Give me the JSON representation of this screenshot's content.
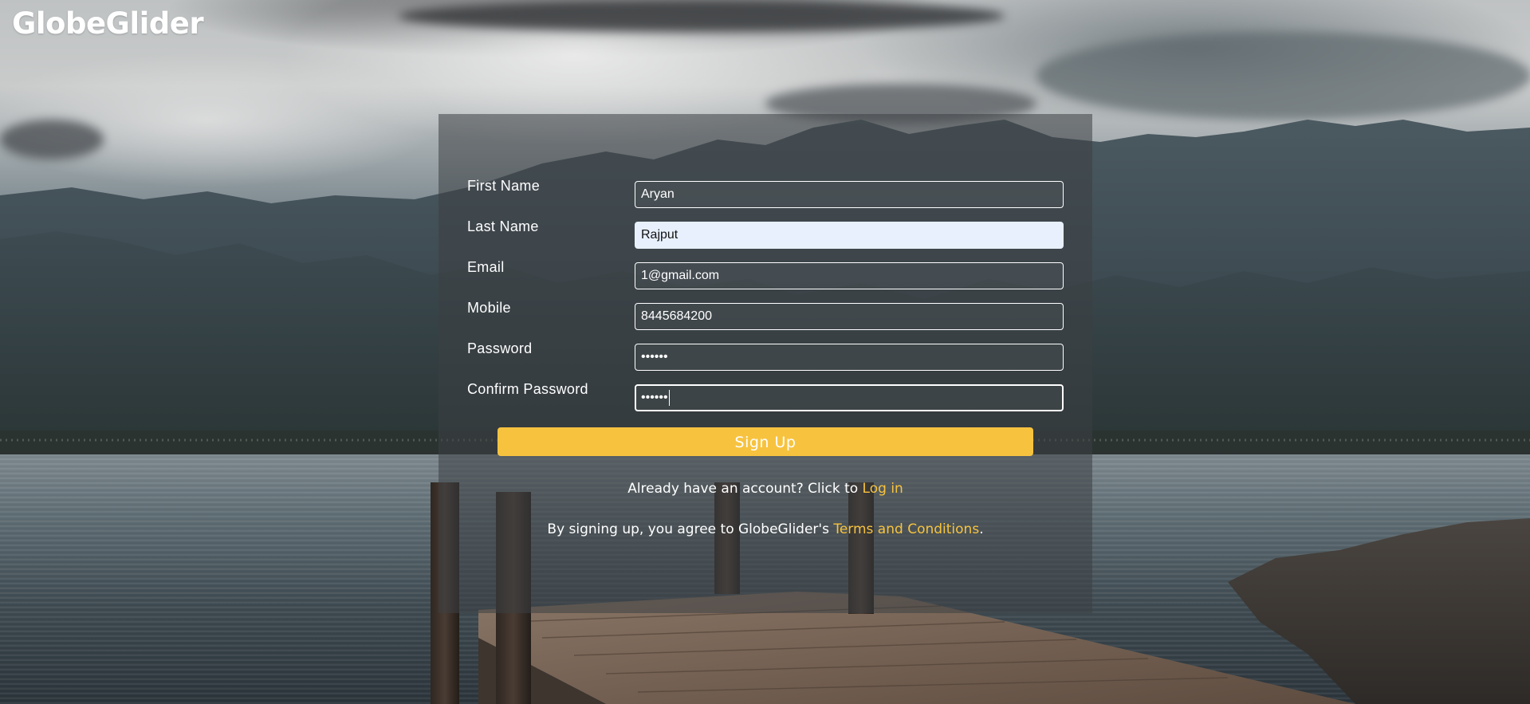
{
  "brand": {
    "name": "GlobeGlider"
  },
  "form": {
    "fields": [
      {
        "label": "First Name",
        "value": "Aryan",
        "type": "text",
        "state": "default"
      },
      {
        "label": "Last Name",
        "value": "Rajput",
        "type": "text",
        "state": "autofilled"
      },
      {
        "label": "Email",
        "value": "1@gmail.com",
        "type": "email",
        "state": "default"
      },
      {
        "label": "Mobile",
        "value": "8445684200",
        "type": "tel",
        "state": "default"
      },
      {
        "label": "Password",
        "value": "••••••",
        "type": "password",
        "state": "default"
      },
      {
        "label": "Confirm Password",
        "value": "••••••",
        "type": "password",
        "state": "focused"
      }
    ],
    "submit_label": "Sign Up"
  },
  "login_note": {
    "prefix": "Already have an account? Click to ",
    "link_text": "Log in"
  },
  "terms_note": {
    "prefix": "By signing up, you agree to GlobeGlider's ",
    "link_text": "Terms and Conditions",
    "suffix": "."
  },
  "colors": {
    "accent": "#f7c33f",
    "panel_overlay": "rgba(60, 64, 68, 0.55)",
    "autofill_bg": "#e8f0fe",
    "text": "#ffffff"
  },
  "background": {
    "scene": "mountain-lake-with-wooden-pier"
  }
}
